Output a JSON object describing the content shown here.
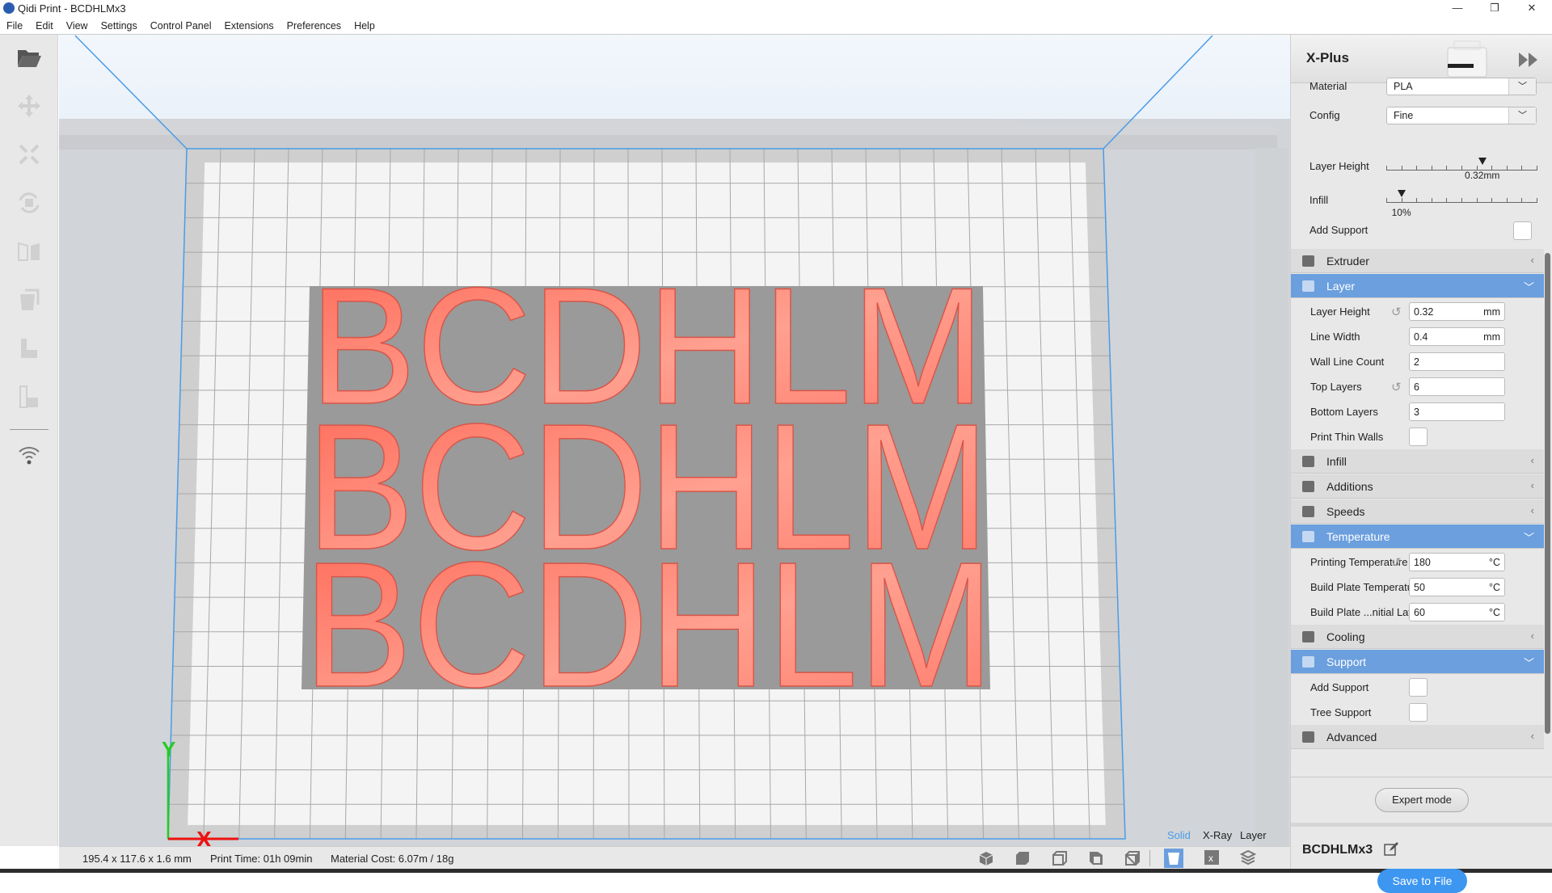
{
  "window": {
    "title": "Qidi Print - BCDHLMx3",
    "controls": [
      "—",
      "❐",
      "✕"
    ]
  },
  "menu": [
    "File",
    "Edit",
    "View",
    "Settings",
    "Control Panel",
    "Extensions",
    "Preferences",
    "Help"
  ],
  "toolbar": [
    "folder-open",
    "move",
    "scale",
    "rotate",
    "mirror",
    "per-model-settings",
    "support-blocker",
    "support-eraser",
    "wifi"
  ],
  "model": {
    "text": "BCDHLM",
    "copies": 3,
    "color": "#ff7a6a",
    "base_color": "#9a9a9a"
  },
  "axes": {
    "x": "X",
    "y": "Y"
  },
  "status": {
    "dimensions": "195.4 x 117.6 x 1.6 mm",
    "print_time": "Print Time: 01h 09min",
    "material_cost": "Material Cost: 6.07m / 18g"
  },
  "view_modes": {
    "solid": "Solid",
    "xray": "X-Ray",
    "layer": "Layer",
    "active": "Solid"
  },
  "view_buttons": [
    "3d-view",
    "front-view",
    "top-view",
    "left-view",
    "right-view",
    "solid-view",
    "xray-view",
    "layer-view"
  ],
  "panel": {
    "printer": "X-Plus",
    "material_label": "Material",
    "material_value": "PLA",
    "config_label": "Config",
    "config_value": "Fine",
    "layer_height_label": "Layer Height",
    "layer_height_value": "0.32mm",
    "layer_height_fraction": 0.64,
    "infill_label": "Infill",
    "infill_value": "10%",
    "infill_fraction": 0.1,
    "add_support_label": "Add Support",
    "add_support_checked": false,
    "sections": {
      "extruder": "Extruder",
      "layer": "Layer",
      "infill": "Infill",
      "additions": "Additions",
      "speeds": "Speeds",
      "temperature": "Temperature",
      "cooling": "Cooling",
      "support": "Support",
      "advanced": "Advanced"
    },
    "layer_rows": [
      {
        "label": "Layer Height",
        "value": "0.32",
        "unit": "mm"
      },
      {
        "label": "Line Width",
        "value": "0.4",
        "unit": "mm"
      },
      {
        "label": "Wall Line Count",
        "value": "2",
        "unit": ""
      },
      {
        "label": "Top Layers",
        "value": "6",
        "unit": ""
      },
      {
        "label": "Bottom Layers",
        "value": "3",
        "unit": ""
      },
      {
        "label": "Print Thin Walls"
      }
    ],
    "temp_rows": [
      {
        "label": "Printing Temperature",
        "value": "180",
        "unit": "°C"
      },
      {
        "label": "Build Plate Temperature",
        "value": "50",
        "unit": "°C"
      },
      {
        "label": "Build Plate ...nitial Layer",
        "value": "60",
        "unit": "°C"
      }
    ],
    "support_rows": [
      {
        "label": "Add Support"
      },
      {
        "label": "Tree Support"
      }
    ],
    "expert_mode": "Expert mode",
    "job_name": "BCDHLMx3",
    "save": "Save to File",
    "accent": "#6b9fde"
  }
}
